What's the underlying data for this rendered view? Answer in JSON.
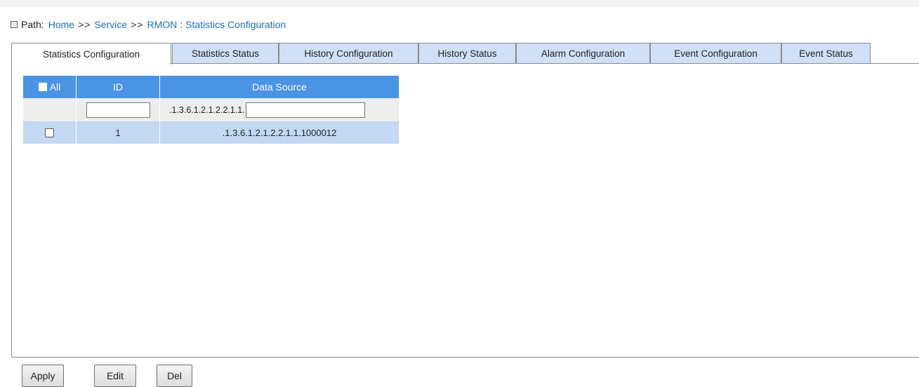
{
  "path": {
    "label": "Path:",
    "home": "Home",
    "sep1": ">>",
    "service": "Service",
    "sep2": ">>",
    "rmon": "RMON",
    "sep3": ":",
    "current": "Statistics Configuration"
  },
  "tabs": [
    {
      "label": "Statistics Configuration",
      "active": true
    },
    {
      "label": "Statistics Status"
    },
    {
      "label": "History Configuration"
    },
    {
      "label": "History Status"
    },
    {
      "label": "Alarm Configuration"
    },
    {
      "label": "Event Configuration"
    },
    {
      "label": "Event Status"
    }
  ],
  "table": {
    "headers": {
      "all": "All",
      "id": "ID",
      "data_source": "Data Source"
    },
    "input_row": {
      "id_value": "",
      "data_source_prefix": ".1.3.6.1.2.1.2.2.1.1.",
      "data_source_value": ""
    },
    "rows": [
      {
        "checked": false,
        "id": "1",
        "data_source": ".1.3.6.1.2.1.2.2.1.1.1000012"
      }
    ]
  },
  "buttons": {
    "apply": "Apply",
    "edit": "Edit",
    "del": "Del"
  }
}
